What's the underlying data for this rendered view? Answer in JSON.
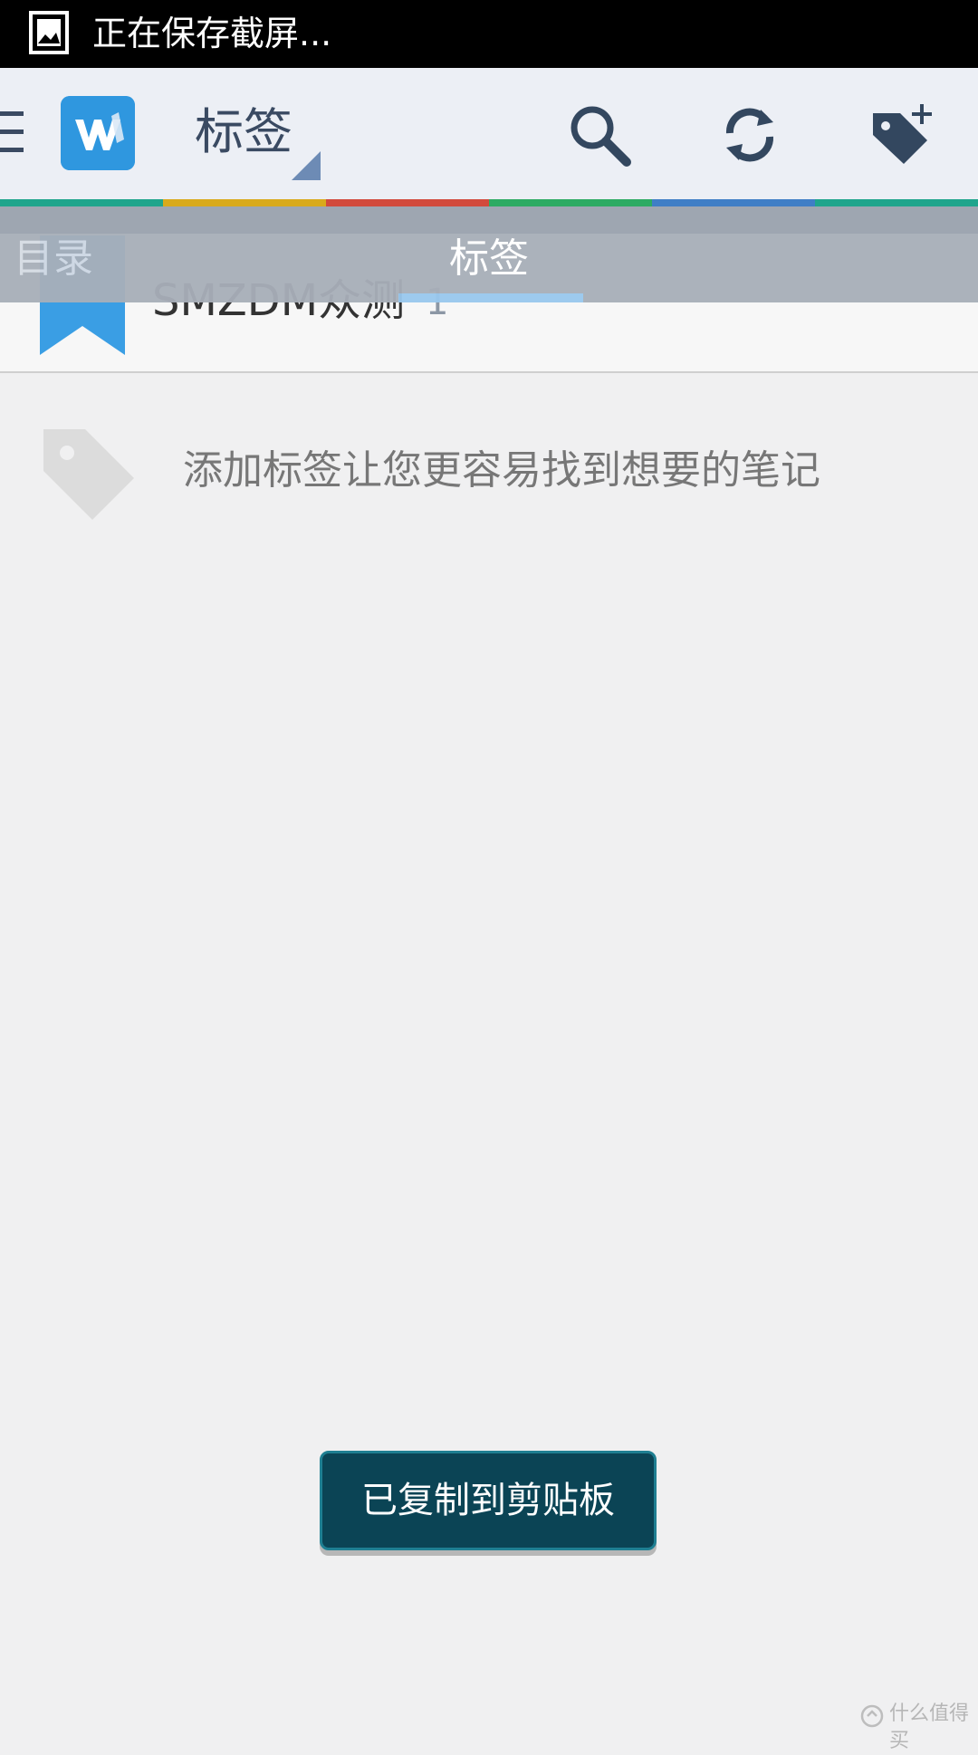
{
  "status_bar": {
    "text": "正在保存截屏..."
  },
  "app_bar": {
    "title": "标签",
    "icons": [
      "menu-icon",
      "app-logo-icon",
      "dropdown-triangle-icon",
      "search-icon",
      "sync-icon",
      "add-tag-icon"
    ]
  },
  "color_strip": [
    "#1fa58c",
    "#d9aa1b",
    "#d24a3c",
    "#2dab63",
    "#3f7ec6",
    "#1fa58c"
  ],
  "tabs": {
    "left": "目录",
    "right": "标签"
  },
  "tag_list": [
    {
      "name": "SMZDM众测",
      "count": "1"
    }
  ],
  "empty_state": {
    "message": "添加标签让您更容易找到想要的笔记"
  },
  "toast": {
    "message": "已复制到剪贴板"
  },
  "watermark": {
    "text": "什么值得买"
  }
}
